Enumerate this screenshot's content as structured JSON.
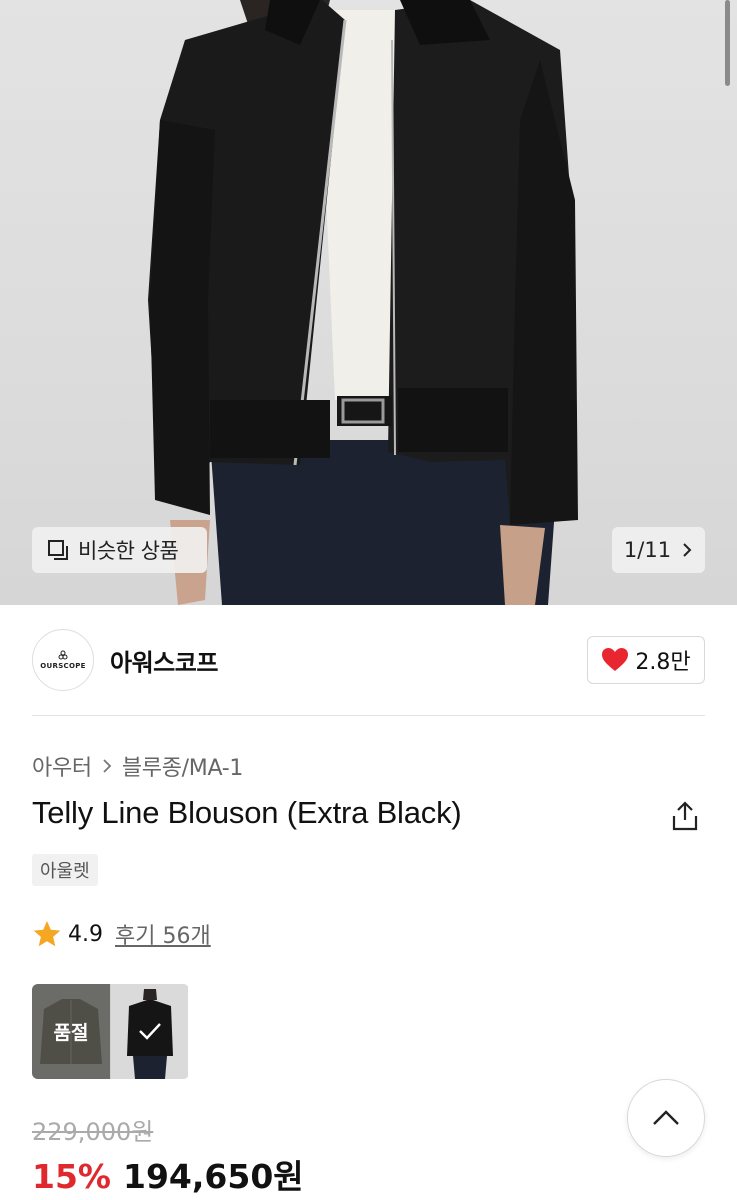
{
  "gallery": {
    "similar_label": "비슷한 상품",
    "counter": "1/11"
  },
  "brand": {
    "logo_text": "OURSCOPE",
    "name": "아워스코프",
    "likes": "2.8만"
  },
  "product": {
    "breadcrumb": [
      "아우터",
      "블루종/MA-1"
    ],
    "title": "Telly Line Blouson (Extra Black)",
    "tag": "아울렛",
    "rating": "4.9",
    "reviews": "후기 56개"
  },
  "options": {
    "soldout_label": "품절"
  },
  "price": {
    "original": "229,000원",
    "discount": "15%",
    "final": "194,650원"
  },
  "colors": {
    "heart": "#e8262f",
    "star": "#f5a623",
    "discount": "#e0282f"
  },
  "icons": [
    "similar-icon",
    "chevron-right-icon",
    "heart-icon",
    "share-icon",
    "star-icon",
    "check-icon",
    "chevron-up-icon"
  ]
}
